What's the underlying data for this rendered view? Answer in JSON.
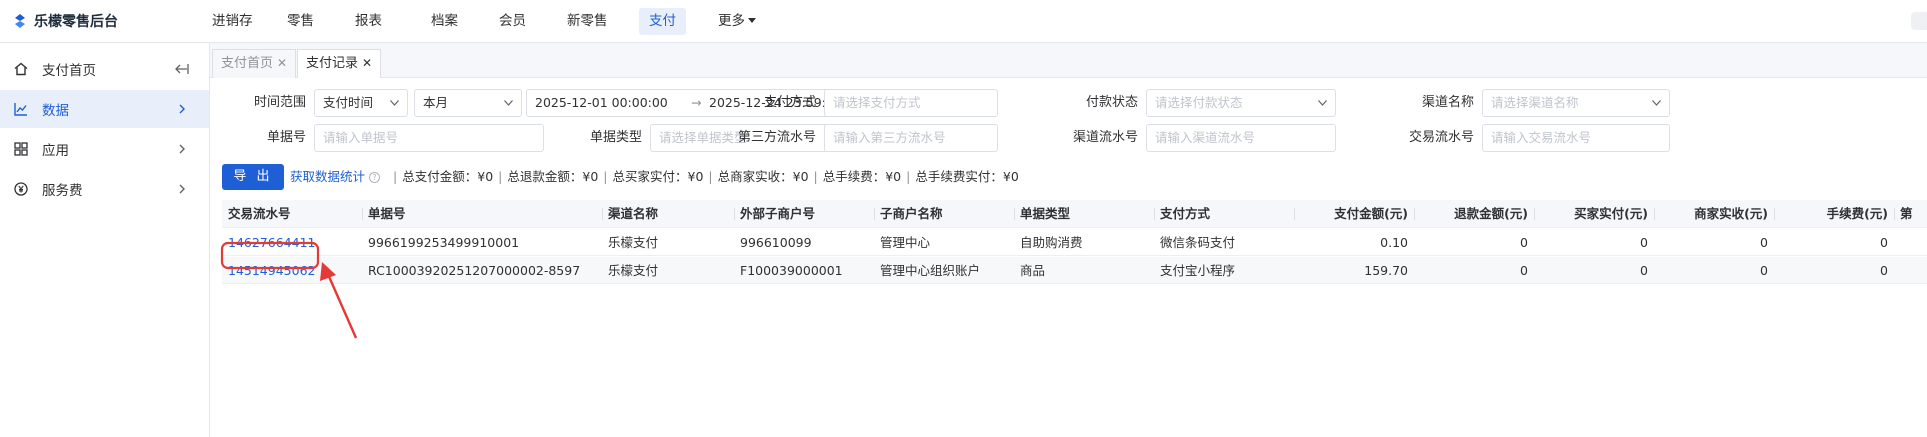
{
  "app": {
    "title": "乐檬零售后台"
  },
  "topnav": {
    "items": [
      {
        "label": "进销存"
      },
      {
        "label": "零售"
      },
      {
        "label": "报表"
      },
      {
        "label": "档案"
      },
      {
        "label": "会员"
      },
      {
        "label": "新零售"
      },
      {
        "label": "支付",
        "active": true
      },
      {
        "label": "更多"
      }
    ]
  },
  "sidebar": {
    "items": [
      {
        "label": "支付首页",
        "icon": "home-icon"
      },
      {
        "label": "数据",
        "icon": "chart-line-icon",
        "active": true
      },
      {
        "label": "应用",
        "icon": "apps-grid-icon"
      },
      {
        "label": "服务费",
        "icon": "currency-icon"
      }
    ]
  },
  "tabs": [
    {
      "label": "支付首页",
      "active": false
    },
    {
      "label": "支付记录",
      "active": true
    }
  ],
  "filters": {
    "time_range_label": "时间范围",
    "time_type_value": "支付时间",
    "period_value": "本月",
    "date_start": "2025-12-01 00:00:00",
    "date_sep": "→",
    "date_end": "2025-12-24 23:59:59",
    "pay_method_label": "支付方式",
    "pay_method_placeholder": "请选择支付方式",
    "pay_status_label": "付款状态",
    "pay_status_placeholder": "请选择付款状态",
    "channel_name_label": "渠道名称",
    "channel_name_placeholder": "请选择渠道名称",
    "order_no_label": "单据号",
    "order_no_placeholder": "请输入单据号",
    "order_type_label": "单据类型",
    "order_type_placeholder": "请选择单据类型",
    "third_serial_label": "第三方流水号",
    "third_serial_placeholder": "请输入第三方流水号",
    "channel_serial_label": "渠道流水号",
    "channel_serial_placeholder": "请输入渠道流水号",
    "trade_serial_label": "交易流水号",
    "trade_serial_placeholder": "请输入交易流水号"
  },
  "toolbar": {
    "export_label": "导 出",
    "fetch_stats_label": "获取数据统计",
    "info_glyph": "?",
    "separator": "|",
    "stats": [
      "总支付金额：¥0",
      "总退款金额：¥0",
      "总买家实付：¥0",
      "总商家实收：¥0",
      "总手续费：¥0",
      "总手续费实付：¥0"
    ]
  },
  "table": {
    "columns": [
      "交易流水号",
      "单据号",
      "渠道名称",
      "外部子商户号",
      "子商户名称",
      "单据类型",
      "支付方式",
      "支付金额(元)",
      "退款金额(元)",
      "买家实付(元)",
      "商家实收(元)",
      "手续费(元)",
      "第"
    ],
    "rows": [
      [
        "14627664411",
        "9966199253499910001",
        "乐檬支付",
        "996610099",
        "管理中心",
        "自助购消费",
        "微信条码支付",
        "0.10",
        "0",
        "0",
        "0",
        "0"
      ],
      [
        "14514945062",
        "RC10003920251207000002-8597",
        "乐檬支付",
        "F100039000001",
        "管理中心组织账户",
        "商品",
        "支付宝小程序",
        "159.70",
        "0",
        "0",
        "0",
        "0"
      ]
    ]
  },
  "colors": {
    "accent": "#1f5fd6",
    "annotation": "#e53935"
  }
}
